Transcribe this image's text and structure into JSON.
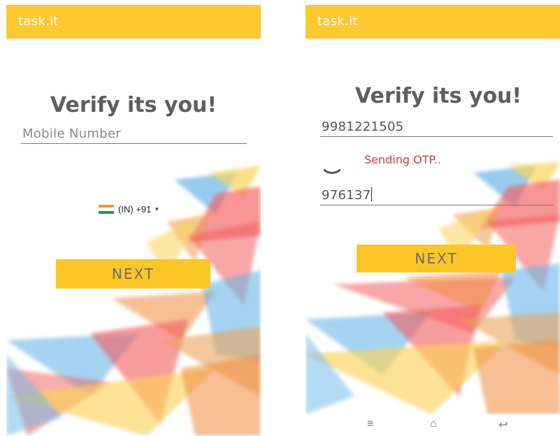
{
  "left": {
    "app_title": "task.it",
    "heading": "Verify its you!",
    "mobile_placeholder": "Mobile Number",
    "country_code": "(IN) +91",
    "next_label": "NEXT"
  },
  "right": {
    "app_title": "task.it",
    "heading": "Verify its you!",
    "mobile_value": "9981221505",
    "status_text": "Sending OTP..",
    "otp_value": "976137",
    "next_label": "NEXT"
  },
  "navbar": {
    "menu_icon": "≡",
    "home_icon": "⌂",
    "back_icon": "↩"
  },
  "colors": {
    "accent": "#fec82f",
    "status": "#d33a3a",
    "heading": "#5e5e5e"
  }
}
